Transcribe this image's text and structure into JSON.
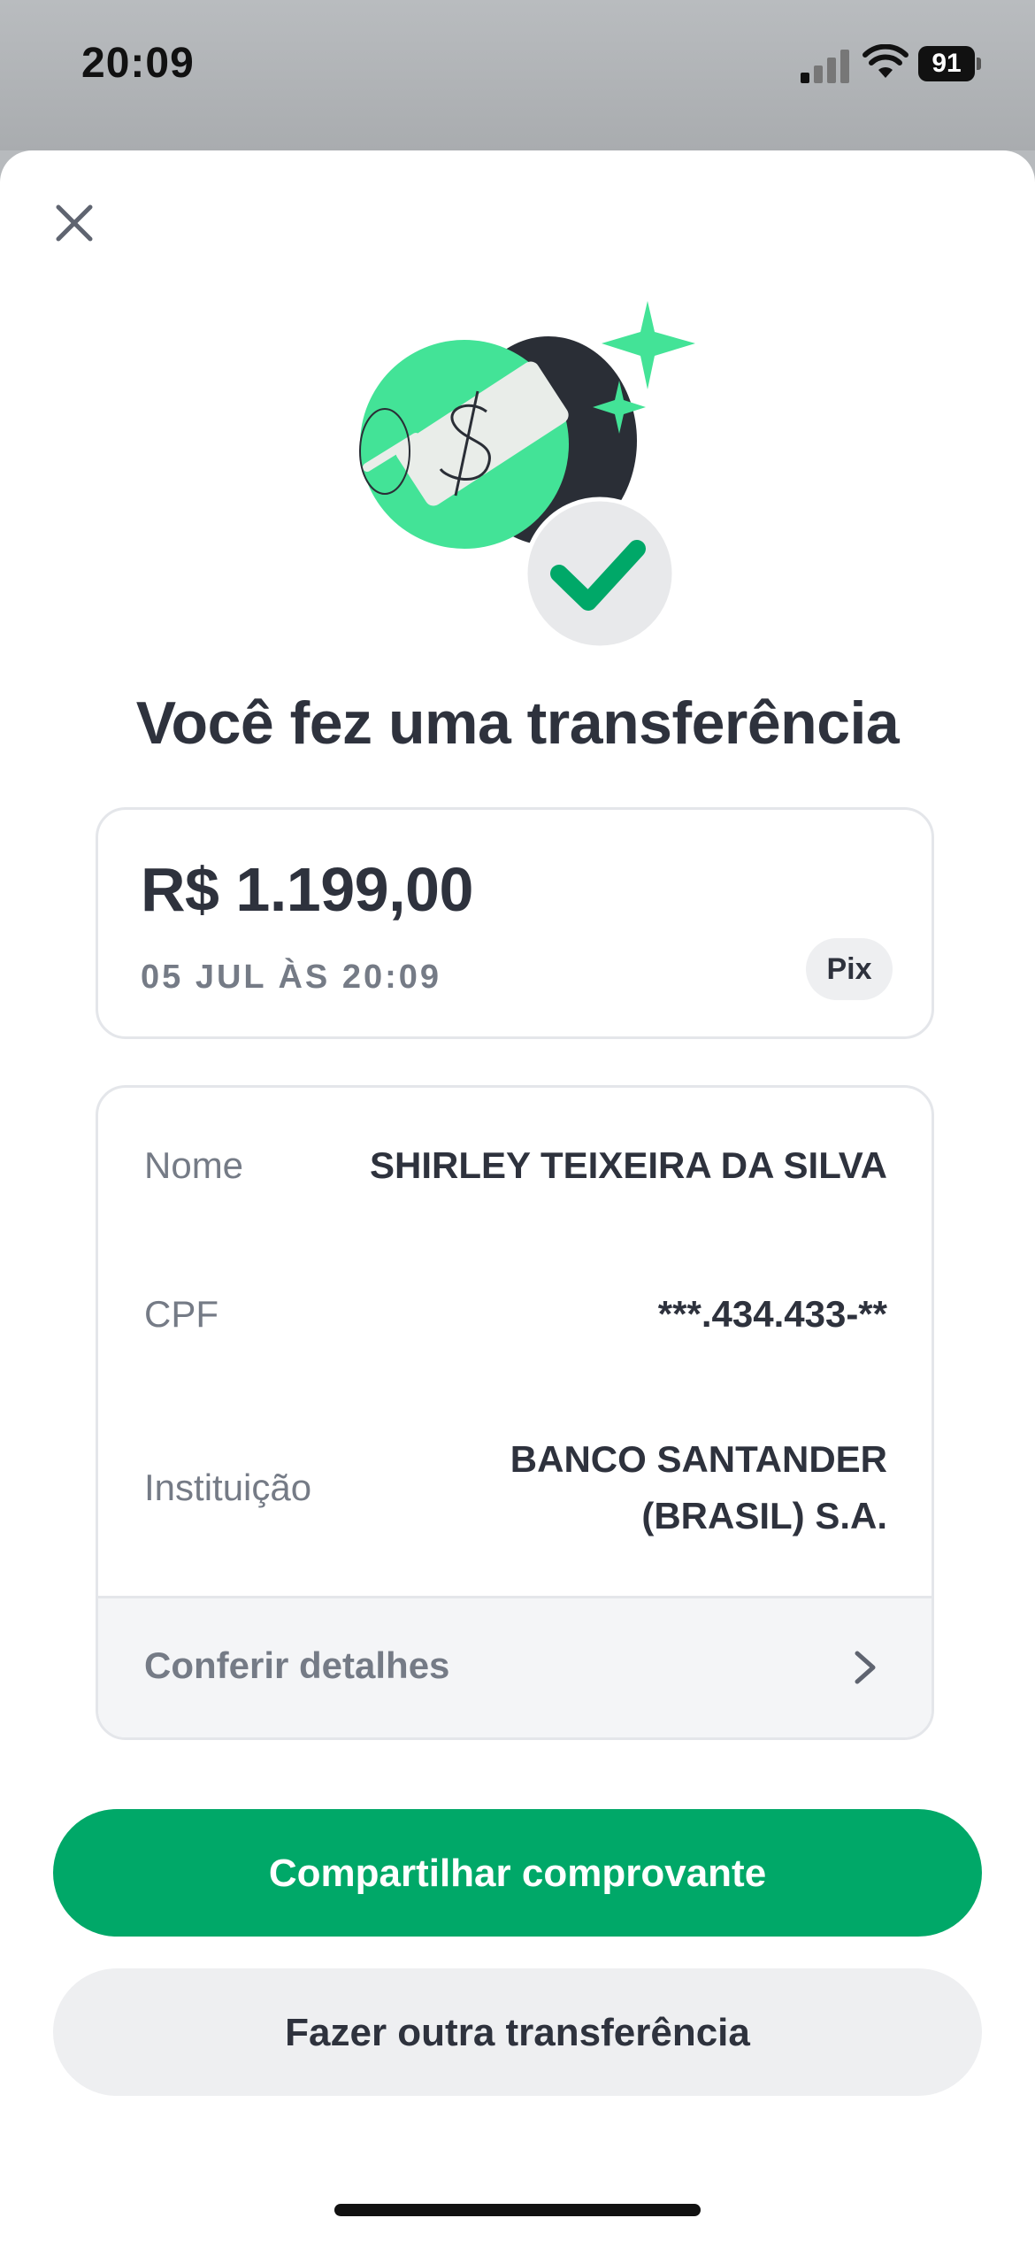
{
  "status_bar": {
    "time": "20:09",
    "battery": "91",
    "icons": [
      "signal-icon",
      "wifi-icon",
      "battery-icon"
    ]
  },
  "colors": {
    "accent": "#00a868",
    "hero_green": "#43e397",
    "text_dark": "#2e323d",
    "text_muted": "#757b86"
  },
  "sheet": {
    "close_icon": "close-icon",
    "hero_icon": "money-success-illustration",
    "title": "Você fez uma transferência"
  },
  "amount_card": {
    "amount": "R$ 1.199,00",
    "date": "05 JUL ÀS 20:09",
    "method_badge": "Pix"
  },
  "details": {
    "rows": [
      {
        "label": "Nome",
        "value": "SHIRLEY TEIXEIRA DA SILVA"
      },
      {
        "label": "CPF",
        "value": "***.434.433-**"
      },
      {
        "label": "Instituição",
        "value": "BANCO SANTANDER (BRASIL) S.A."
      }
    ],
    "footer_label": "Conferir detalhes"
  },
  "actions": {
    "share_label": "Compartilhar comprovante",
    "new_transfer_label": "Fazer outra transferência"
  }
}
